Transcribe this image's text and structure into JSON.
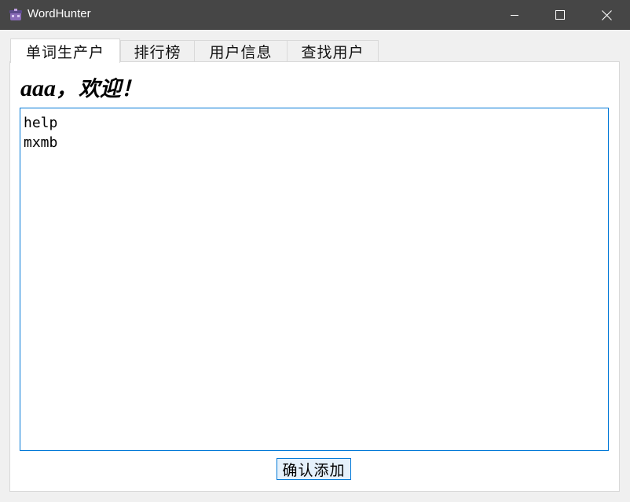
{
  "window": {
    "title": "WordHunter",
    "icon": "wordhunter-app-icon",
    "controls": {
      "minimize": "minimize-icon",
      "maximize": "maximize-icon",
      "close": "close-icon"
    }
  },
  "tabs": [
    {
      "label": "单词生产户",
      "active": true
    },
    {
      "label": "排行榜",
      "active": false
    },
    {
      "label": "用户信息",
      "active": false
    },
    {
      "label": "查找用户",
      "active": false
    }
  ],
  "main": {
    "username": "aaa",
    "greeting_separator": "，",
    "greeting": "欢迎！",
    "words_text": "help\nmxmb",
    "confirm_label": "确认添加"
  },
  "colors": {
    "titlebar": "#464646",
    "accent": "#0078d7",
    "button_bg": "#e5f1fb",
    "background": "#f0f0f0"
  }
}
